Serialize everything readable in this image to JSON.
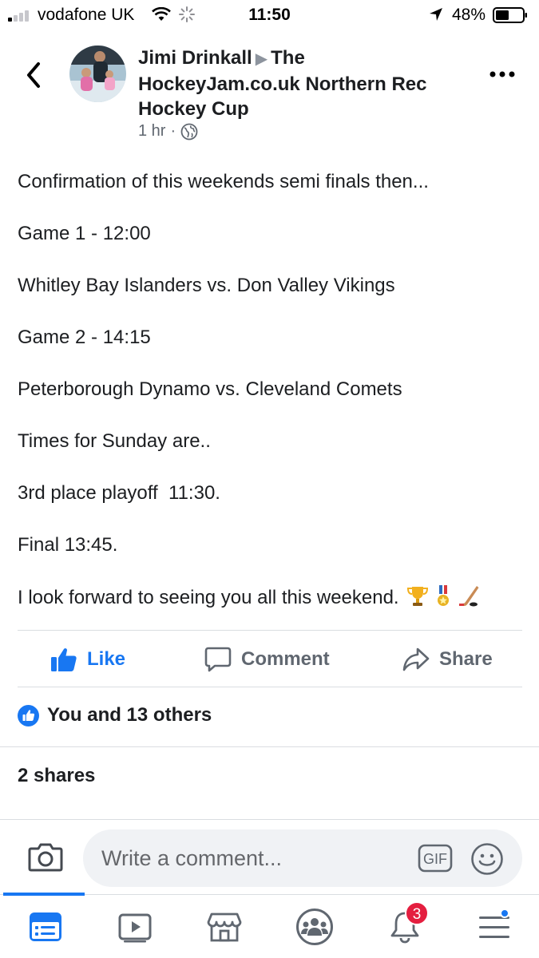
{
  "status_bar": {
    "carrier": "vodafone UK",
    "time": "11:50",
    "battery": "48%"
  },
  "post": {
    "author": "Jimi Drinkall",
    "group": "The HockeyJam.co.uk Northern Rec Hockey Cup",
    "time_ago": "1 hr",
    "separator": "·",
    "lines": [
      "Confirmation of this weekends semi finals then...",
      "Game 1 - 12:00",
      "Whitley Bay Islanders vs. Don Valley Vikings",
      "Game 2 - 14:15",
      "Peterborough Dynamo vs. Cleveland Comets",
      "Times for Sunday are..",
      "3rd place playoff  11:30.",
      "Final 13:45.",
      "I look forward to seeing you all this weekend."
    ],
    "emojis": [
      "trophy-icon",
      "medal-icon",
      "hockey-stick-icon"
    ]
  },
  "actions": {
    "like": "Like",
    "comment": "Comment",
    "share": "Share"
  },
  "reactions_text": "You and 13 others",
  "shares_text": "2 shares",
  "composer": {
    "placeholder": "Write a comment...",
    "gif_label": "GIF"
  },
  "nav": {
    "notifications_badge": "3",
    "active_tab": "news-feed"
  },
  "colors": {
    "accent": "#1877f2",
    "badge": "#e41e3f",
    "text": "#1c1e21",
    "secondary_text": "#606770"
  }
}
